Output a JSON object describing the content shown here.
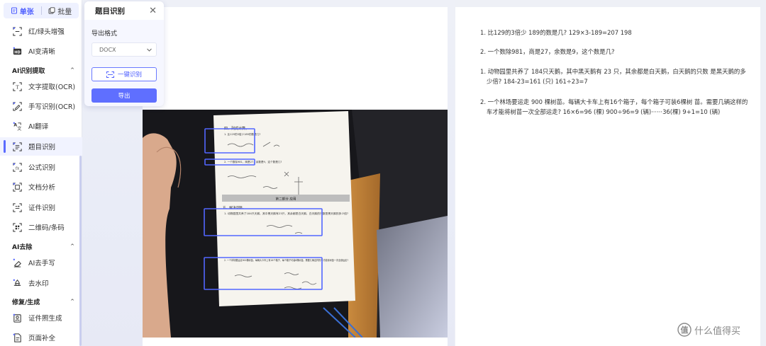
{
  "sidebar": {
    "tabs": [
      {
        "label": "单张",
        "icon": "single-page-icon",
        "active": true
      },
      {
        "label": "批量",
        "icon": "batch-pages-icon",
        "active": false
      }
    ],
    "items_top": [
      {
        "label": "红/绿头增强",
        "icon": "color-enhance-icon"
      },
      {
        "label": "AI变清晰",
        "icon": "hd-icon"
      }
    ],
    "section_ocr": {
      "label": "AI识别提取",
      "chevron": "^"
    },
    "items_ocr": [
      {
        "label": "文字提取(OCR)",
        "icon": "text-extract-icon"
      },
      {
        "label": "手写识别(OCR)",
        "icon": "handwriting-icon"
      },
      {
        "label": "AI翻译",
        "icon": "translate-icon"
      },
      {
        "label": "题目识别",
        "icon": "question-recognition-icon",
        "active": true
      },
      {
        "label": "公式识别",
        "icon": "formula-icon"
      },
      {
        "label": "文档分析",
        "icon": "document-analysis-icon"
      },
      {
        "label": "证件识别",
        "icon": "id-card-icon"
      },
      {
        "label": "二维码/条码",
        "icon": "qrcode-icon"
      }
    ],
    "section_remove": {
      "label": "AI去除",
      "chevron": "^"
    },
    "items_remove": [
      {
        "label": "AI去手写",
        "icon": "erase-handwriting-icon"
      },
      {
        "label": "去水印",
        "icon": "remove-watermark-icon"
      }
    ],
    "section_repair": {
      "label": "修复/生成",
      "chevron": "^"
    },
    "items_repair": [
      {
        "label": "证件照生成",
        "icon": "id-photo-icon"
      },
      {
        "label": "页面补全",
        "icon": "page-complete-icon"
      }
    ]
  },
  "panel": {
    "title": "题目识别",
    "close": "✕",
    "export_format_label": "导出格式",
    "format_value": "DOCX",
    "recognize_button": "一键识别",
    "export_button": "导出"
  },
  "photo_doc": {
    "section4_title": "四、列式计算。",
    "q1": "1. 比129的3倍少189的数是几?",
    "q2": "2. 一个数除981，商是27，余数是9，这个数是几?",
    "part2": "第二部分  应用",
    "section5_title": "五、解决问题。",
    "q3": "1. 动物园里共养了184只天鹅，其中黑天鹅有23只，其余都是白天鹅，白天鹅的只数是黑天鹅的多少倍?",
    "q4": "2. 一个林场要运走900棵树苗。每辆大卡车上有16个箱子，每个箱子可装6棵树苗。需要几辆这样的车才能将树苗一次全部运走?"
  },
  "results": [
    {
      "text": "1. 比129的3倍少 189的数是几? 129×3-189=207 198"
    },
    {
      "text": "2. 一个数除981，商是27，余数是9，这个数是几?"
    },
    {
      "text": "1. 动物园里共养了 184只天鹅，其中黑天鹅有 23 只，其余都是白天鹅，白天鹅的只数 是黑天鹅的多少倍? 184-23=161 (只) 161÷23=7"
    },
    {
      "text": "2. 一个林场要运走 900 棵树苗。每辆大卡车上有16个箱子，每个箱子可装6棵树 苗。需要几辆这样的车才能将树苗一次全部运走? 16×6=96 (棵) 900÷96=9 (辆)······36(棵) 9+1=10 (辆)"
    }
  ],
  "watermark": {
    "text": "什么值得买",
    "icon": "zhi-logo-icon"
  }
}
